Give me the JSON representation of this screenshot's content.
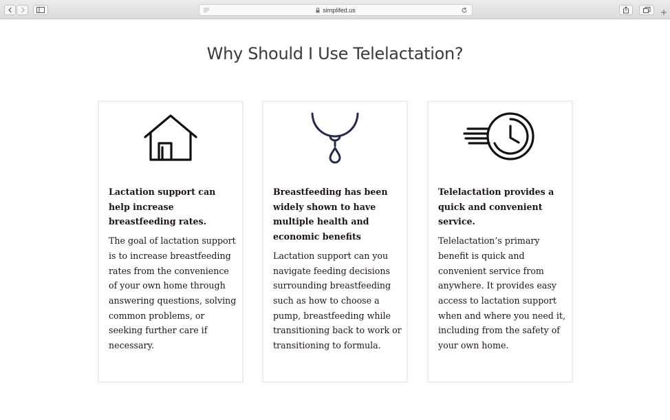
{
  "browser": {
    "url": "simplifed.us"
  },
  "page": {
    "title": "Why Should I Use Telelactation?"
  },
  "cards": [
    {
      "icon": "house-icon",
      "heading": "Lactation support can help increase breastfeeding rates.",
      "text": "The goal of lactation support is to increase breastfeeding rates from the convenience of your own home through answering questions, solving common problems, or seeking further care if necessary."
    },
    {
      "icon": "breast-milk-drop-icon",
      "heading": "Breastfeeding has been widely shown to have multiple health and economic benefits",
      "text": "Lactation support can you navigate feeding decisions surrounding breastfeeding such as how to choose a pump, breastfeeding while transitioning back to work or transitioning to formula."
    },
    {
      "icon": "fast-clock-icon",
      "heading": "Telelactation provides a quick and convenient service.",
      "text": "Telelactation’s primary benefit is quick and convenient service from anywhere. It provides easy access to lactation support when and where you need it, including from the safety of your own home."
    }
  ],
  "colors": {
    "card_border": "#f6eaed",
    "icon_navy": "#262a4a",
    "text": "#1f1414"
  }
}
